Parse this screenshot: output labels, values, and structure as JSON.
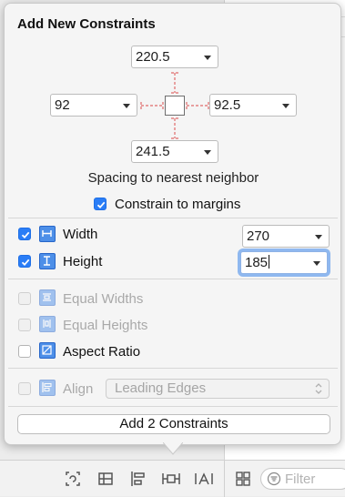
{
  "popover": {
    "title": "Add New Constraints",
    "spacing": {
      "top": "220.5",
      "left": "92",
      "right": "92.5",
      "bottom": "241.5",
      "caption": "Spacing to nearest neighbor"
    },
    "constrain_to_margins": {
      "label": "Constrain to margins",
      "checked": true
    },
    "width": {
      "label": "Width",
      "checked": true,
      "value": "270"
    },
    "height": {
      "label": "Height",
      "checked": true,
      "value": "185"
    },
    "equal_widths": {
      "label": "Equal Widths",
      "checked": false,
      "enabled": false
    },
    "equal_heights": {
      "label": "Equal Heights",
      "checked": false,
      "enabled": false
    },
    "aspect_ratio": {
      "label": "Aspect Ratio",
      "checked": false,
      "enabled": true
    },
    "align": {
      "label": "Align",
      "checked": false,
      "enabled": false,
      "value": "Leading Edges"
    },
    "add_button": "Add 2 Constraints"
  },
  "background": {
    "filter_placeholder": "Filter"
  },
  "colors": {
    "accent": "#2a7df6",
    "strut_red": "#e06a6a",
    "constraint_icon_blue": "#4d8fe8"
  }
}
